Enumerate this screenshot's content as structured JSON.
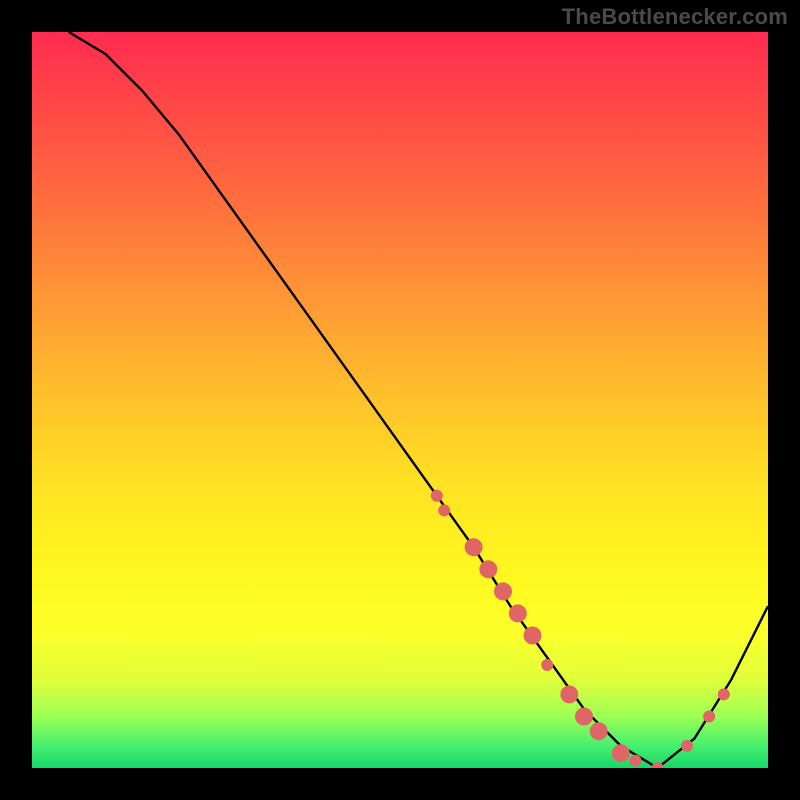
{
  "watermark": "TheBottlenecker.com",
  "chart_data": {
    "type": "line",
    "title": "",
    "xlabel": "",
    "ylabel": "",
    "xlim": [
      0,
      100
    ],
    "ylim": [
      0,
      100
    ],
    "grid": false,
    "legend": false,
    "series": [
      {
        "name": "curve",
        "color": "#000000",
        "x": [
          5,
          10,
          15,
          20,
          25,
          30,
          35,
          40,
          45,
          50,
          55,
          60,
          65,
          70,
          75,
          80,
          85,
          90,
          95,
          100
        ],
        "y": [
          100,
          97,
          92,
          86,
          79,
          72,
          65,
          58,
          51,
          44,
          37,
          30,
          22,
          15,
          8,
          3,
          0,
          4,
          12,
          22
        ]
      }
    ],
    "markers": [
      {
        "name": "dots",
        "color": "#e06666",
        "radius_small": 6,
        "radius_large": 9,
        "points": [
          {
            "x": 55,
            "y": 37,
            "r": "small"
          },
          {
            "x": 56,
            "y": 35,
            "r": "small"
          },
          {
            "x": 60,
            "y": 30,
            "r": "large"
          },
          {
            "x": 62,
            "y": 27,
            "r": "large"
          },
          {
            "x": 64,
            "y": 24,
            "r": "large"
          },
          {
            "x": 66,
            "y": 21,
            "r": "large"
          },
          {
            "x": 68,
            "y": 18,
            "r": "large"
          },
          {
            "x": 70,
            "y": 14,
            "r": "small"
          },
          {
            "x": 73,
            "y": 10,
            "r": "large"
          },
          {
            "x": 75,
            "y": 7,
            "r": "large"
          },
          {
            "x": 77,
            "y": 5,
            "r": "large"
          },
          {
            "x": 80,
            "y": 2,
            "r": "large"
          },
          {
            "x": 82,
            "y": 1,
            "r": "small"
          },
          {
            "x": 85,
            "y": 0,
            "r": "small"
          },
          {
            "x": 89,
            "y": 3,
            "r": "small"
          },
          {
            "x": 92,
            "y": 7,
            "r": "small"
          },
          {
            "x": 94,
            "y": 10,
            "r": "small"
          }
        ]
      }
    ],
    "background_gradient": {
      "top": "#ff2c4f",
      "mid": "#ffe323",
      "bottom": "#17d66a"
    }
  }
}
